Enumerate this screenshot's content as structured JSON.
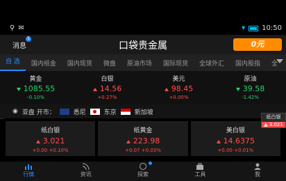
{
  "status": {
    "time": "10:50"
  },
  "appbar": {
    "messages_label": "消息",
    "message_count": "1",
    "title": "口袋贵金属",
    "logo_text": "0元"
  },
  "tabs": [
    "自 选",
    "国内纸金",
    "国内现货",
    "微盘",
    "原油市场",
    "国际现货",
    "全球外汇",
    "国内股指",
    "全"
  ],
  "quotes": [
    {
      "name": "黄金",
      "price": "1085.55",
      "change": "-0.10%",
      "dir": "down"
    },
    {
      "name": "白银",
      "price": "14.56",
      "change": "+0.27%",
      "dir": "up"
    },
    {
      "name": "美元",
      "price": "98.45",
      "change": "+0.00%",
      "dir": "up"
    },
    {
      "name": "原油",
      "price": "39.58",
      "change": "-1.42%",
      "dir": "down"
    }
  ],
  "market": {
    "label": "亚盘 开市：",
    "cities": [
      "悉尼",
      "东京",
      "新加坡"
    ]
  },
  "cards": [
    {
      "name": "纸白银",
      "price": "3.021",
      "change": "+0.00 +0.10%"
    },
    {
      "name": "纸黄金",
      "price": "223.98",
      "change": "+0.07 +0.03%"
    },
    {
      "name": "美白银",
      "price": "14.6375",
      "change": "+0.00 +0.01%"
    }
  ],
  "tooltip": {
    "name": "纸白银",
    "value": "3.021"
  },
  "nav": [
    "行情",
    "资讯",
    "探索",
    "工具",
    "我"
  ]
}
